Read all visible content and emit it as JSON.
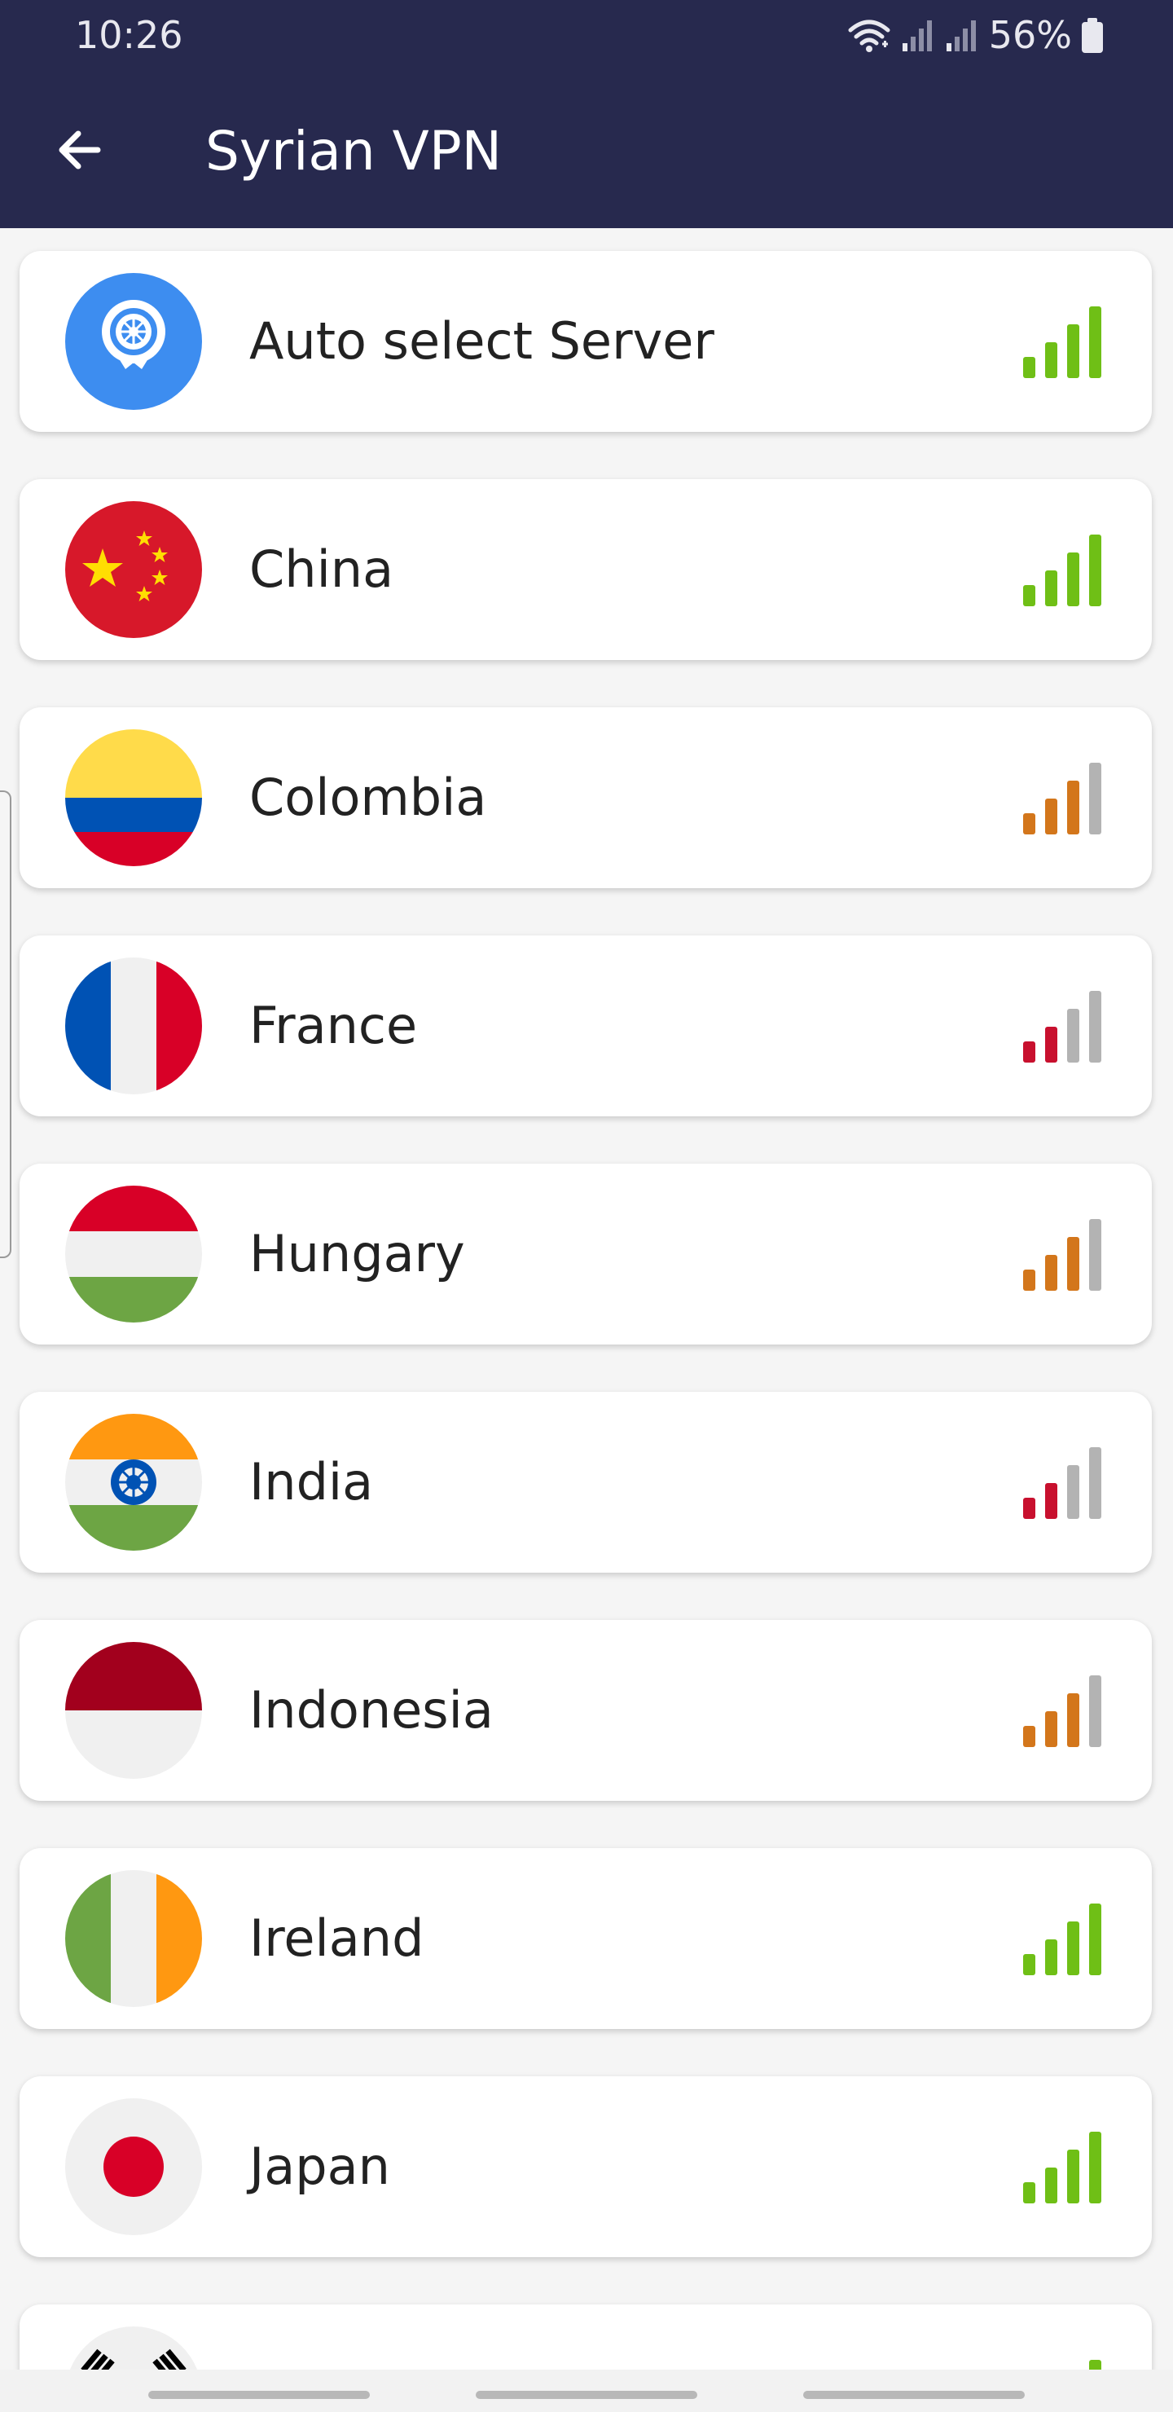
{
  "status_bar": {
    "time": "10:26",
    "battery": "56%",
    "icons": [
      "wifi-icon",
      "signal-icon",
      "signal-icon",
      "battery-icon"
    ]
  },
  "app_bar": {
    "title": "Syrian VPN",
    "back_icon": "arrow-left-icon"
  },
  "colors": {
    "header": "#27294e",
    "signal_good": "#6fbf16",
    "signal_medium": "#d3761b",
    "signal_weak": "#c8102e",
    "signal_empty": "#b3b3b3"
  },
  "servers": [
    {
      "name": "Auto select Server",
      "icon": "auto-server-icon",
      "signal_bars": 4,
      "signal_quality": "good"
    },
    {
      "name": "China",
      "icon": "china-flag-icon",
      "signal_bars": 4,
      "signal_quality": "good"
    },
    {
      "name": "Colombia",
      "icon": "colombia-flag-icon",
      "signal_bars": 3,
      "signal_quality": "medium"
    },
    {
      "name": "France",
      "icon": "france-flag-icon",
      "signal_bars": 2,
      "signal_quality": "weak"
    },
    {
      "name": "Hungary",
      "icon": "hungary-flag-icon",
      "signal_bars": 3,
      "signal_quality": "medium"
    },
    {
      "name": "India",
      "icon": "india-flag-icon",
      "signal_bars": 2,
      "signal_quality": "weak"
    },
    {
      "name": "Indonesia",
      "icon": "indonesia-flag-icon",
      "signal_bars": 3,
      "signal_quality": "medium"
    },
    {
      "name": "Ireland",
      "icon": "ireland-flag-icon",
      "signal_bars": 4,
      "signal_quality": "good"
    },
    {
      "name": "Japan",
      "icon": "japan-flag-icon",
      "signal_bars": 4,
      "signal_quality": "good"
    },
    {
      "name": "",
      "icon": "south-korea-flag-icon",
      "signal_bars": 4,
      "signal_quality": "good"
    }
  ],
  "navigation": {
    "items": [
      "recent-apps-pill",
      "home-pill",
      "back-pill"
    ]
  }
}
